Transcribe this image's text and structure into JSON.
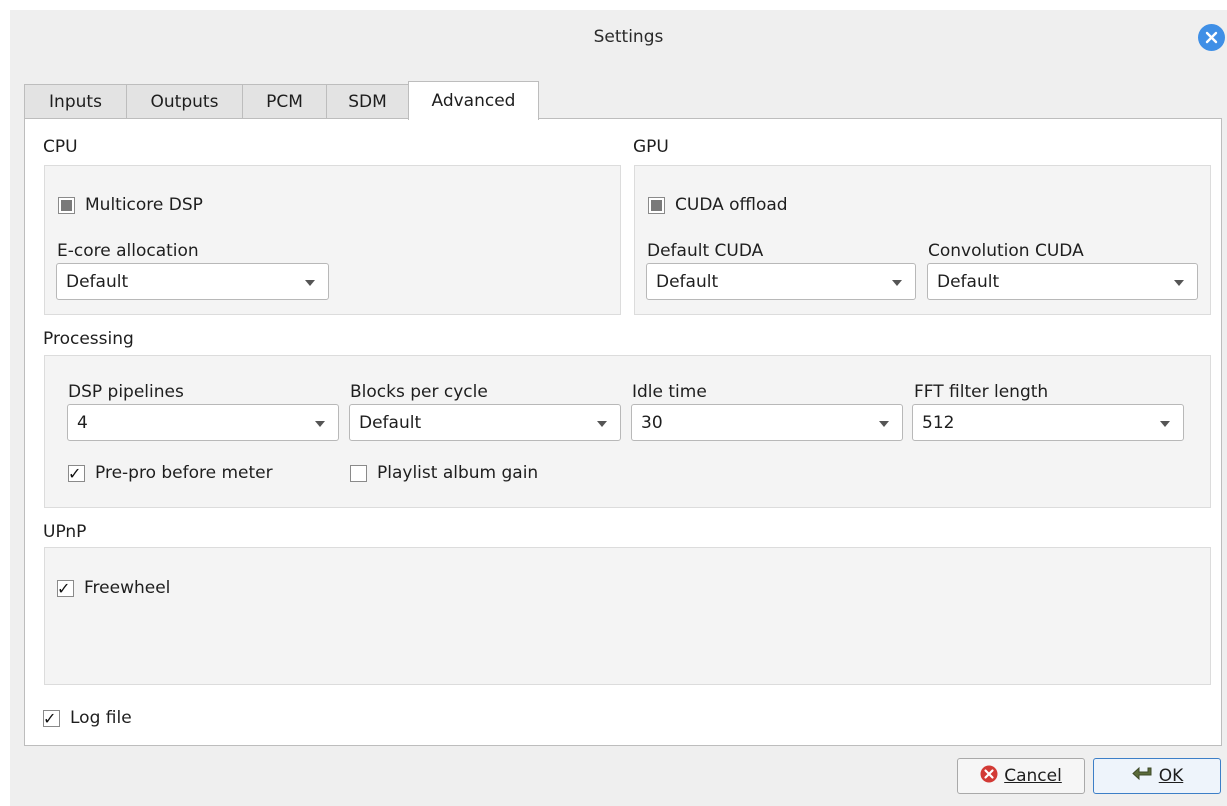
{
  "window": {
    "title": "Settings"
  },
  "tabs": [
    {
      "label": "Inputs",
      "active": false
    },
    {
      "label": "Outputs",
      "active": false
    },
    {
      "label": "PCM",
      "active": false
    },
    {
      "label": "SDM",
      "active": false
    },
    {
      "label": "Advanced",
      "active": true
    }
  ],
  "cpu": {
    "title": "CPU",
    "multicore": {
      "label": "Multicore DSP",
      "state": "partial"
    },
    "ecore": {
      "label": "E-core allocation",
      "value": "Default"
    }
  },
  "gpu": {
    "title": "GPU",
    "cuda": {
      "label": "CUDA offload",
      "state": "partial"
    },
    "default_cuda": {
      "label": "Default CUDA",
      "value": "Default"
    },
    "conv_cuda": {
      "label": "Convolution CUDA",
      "value": "Default"
    }
  },
  "processing": {
    "title": "Processing",
    "pipelines": {
      "label": "DSP pipelines",
      "value": "4"
    },
    "blocks": {
      "label": "Blocks per cycle",
      "value": "Default"
    },
    "idle": {
      "label": "Idle time",
      "value": "30"
    },
    "fft": {
      "label": "FFT filter length",
      "value": "512"
    },
    "prepro": {
      "label": "Pre-pro before meter",
      "checked": true
    },
    "album_gain": {
      "label": "Playlist album gain",
      "checked": false
    }
  },
  "upnp": {
    "title": "UPnP",
    "freewheel": {
      "label": "Freewheel",
      "checked": true
    }
  },
  "logfile": {
    "label": "Log file",
    "checked": true
  },
  "buttons": {
    "cancel": "Cancel",
    "ok": "OK"
  },
  "colors": {
    "close_button": "#3f8fe6",
    "cancel_icon": "#d23a35",
    "ok_border": "#3d7fc7"
  }
}
